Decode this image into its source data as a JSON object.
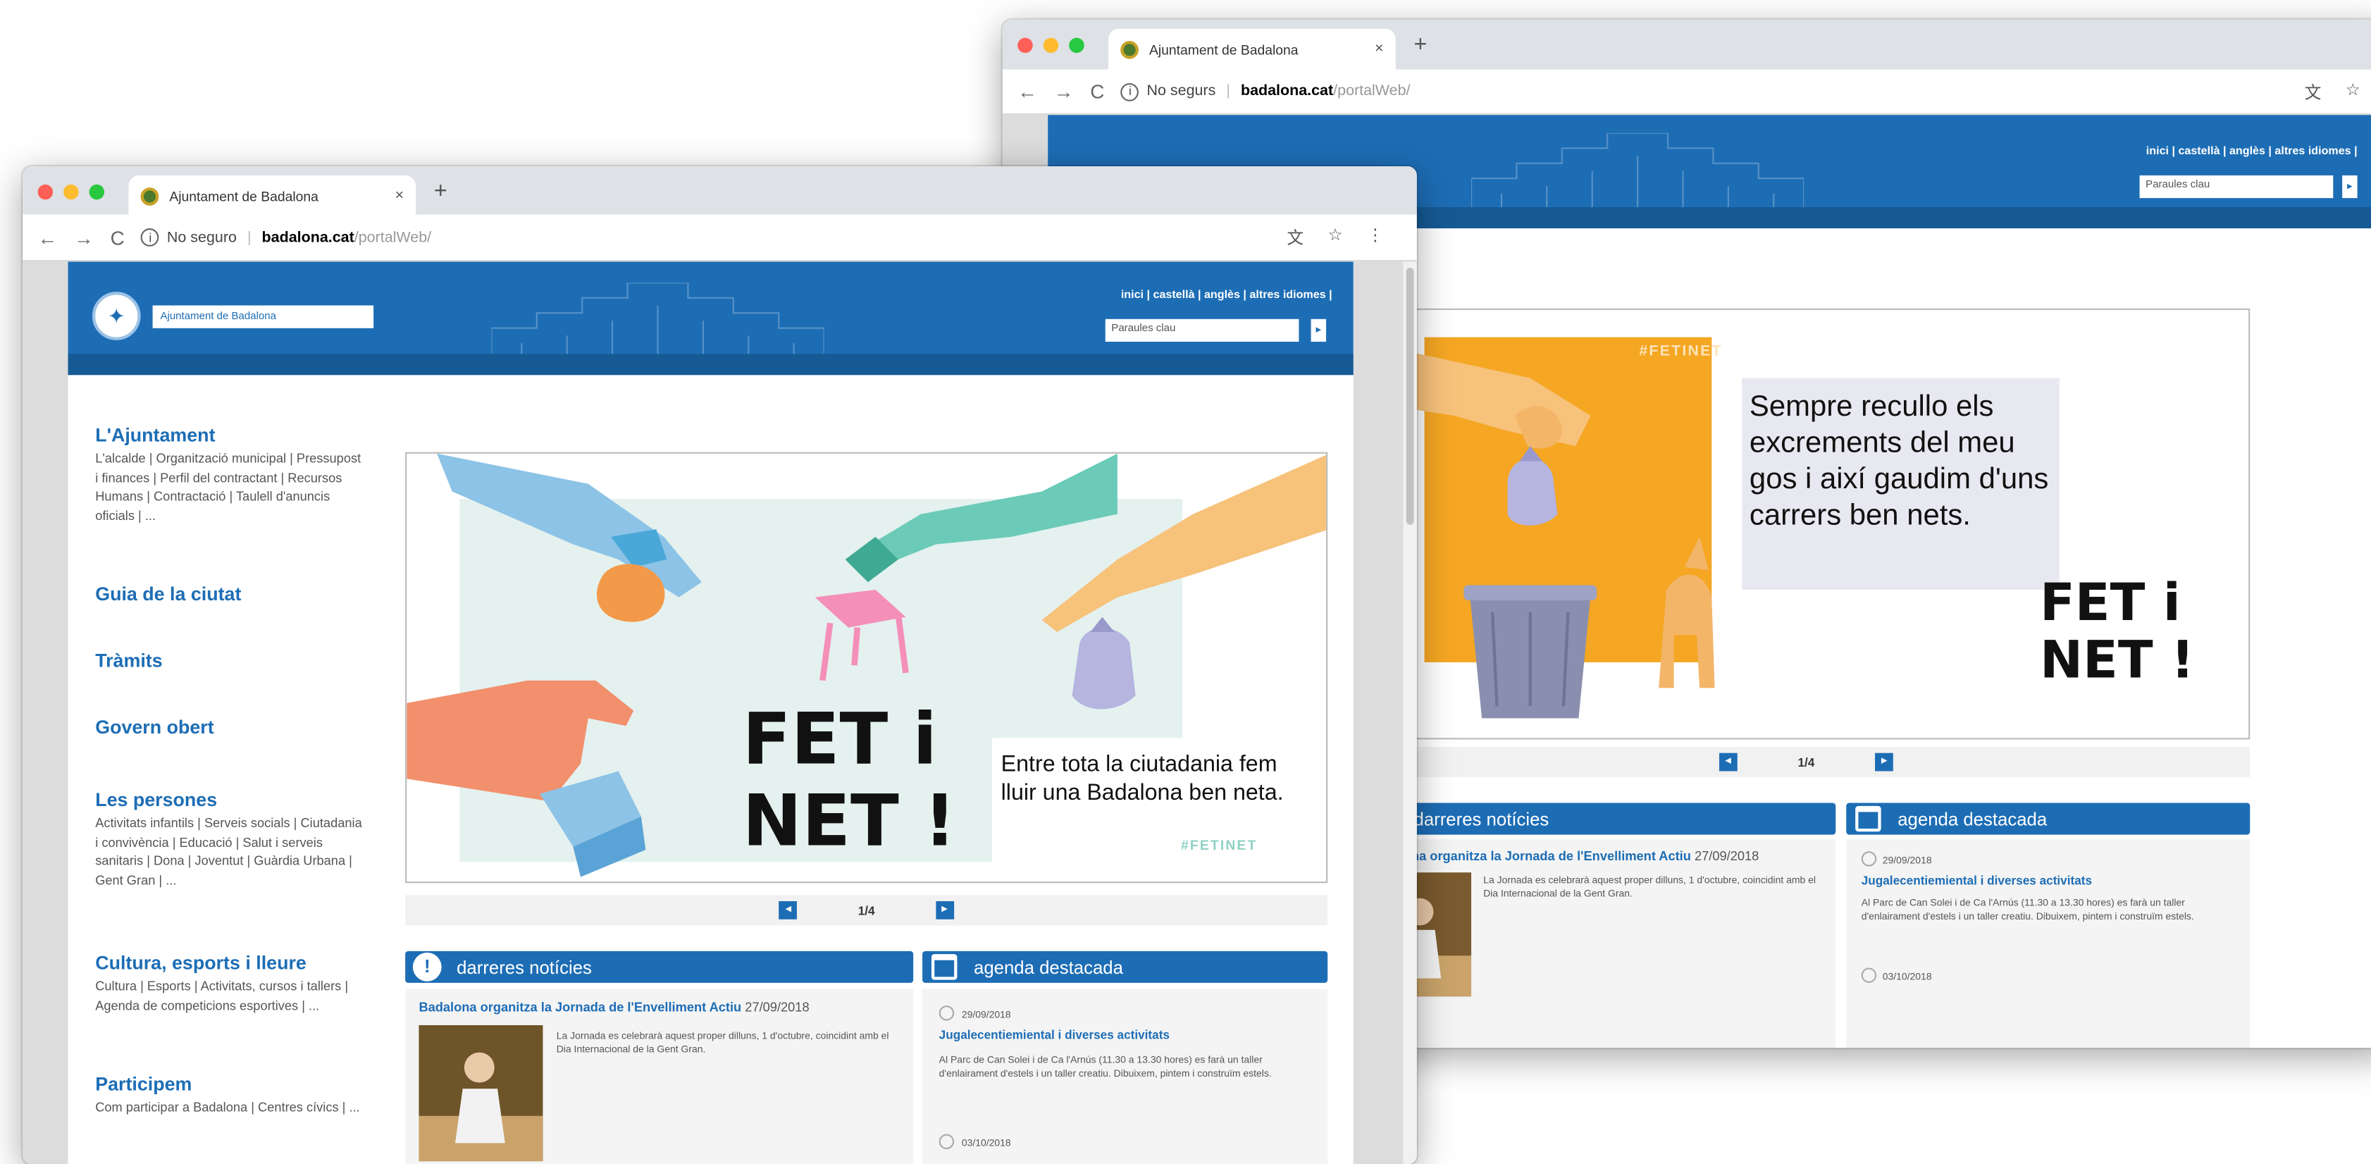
{
  "browser": {
    "tab_title": "Ajuntament de Badalona",
    "tab_close": "×",
    "new_tab": "+",
    "back": "←",
    "forward": "→",
    "reload": "C",
    "info": "i",
    "not_secure": "No seguro",
    "not_secure_back": "No segurs",
    "url_host": "badalona.cat",
    "url_path": "/portalWeb/",
    "translate": "文",
    "bookmark": "☆",
    "menu": "⋮"
  },
  "site": {
    "logo_text": "Ajuntament de Badalona",
    "lang_links": "inici  |  castellà  |  anglès  |  altres idiomes  |",
    "search_placeholder": "Paraules clau",
    "search_go": "▸"
  },
  "sidebar": [
    {
      "heading": "L'Ajuntament",
      "text": "L'alcalde | Organització municipal | Pressupost i finances | Perfil del contractant | Recursos Humans | Contractació | Taulell d'anuncis oficials | ..."
    },
    {
      "heading": "Guia de la ciutat",
      "text": ""
    },
    {
      "heading": "Tràmits",
      "text": ""
    },
    {
      "heading": "Govern obert",
      "text": ""
    },
    {
      "heading": "Les persones",
      "text": "Activitats infantils | Serveis socials | Ciutadania i convivència | Educació | Salut i serveis sanitaris | Dona | Joventut | Guàrdia Urbana | Gent Gran | ..."
    },
    {
      "heading": "Cultura, esports i lleure",
      "text": "Cultura | Esports | Activitats, cursos i tallers | Agenda de competicions esportives | ..."
    },
    {
      "heading": "Participem",
      "text": "Com participar a Badalona | Centres cívics | ..."
    }
  ],
  "banner_front": {
    "fet": "FET i",
    "net": "NET !",
    "caption": "Entre tota la ciutadania fem lluir una Badalona ben neta.",
    "hashtag": "#FETINET"
  },
  "banner_back": {
    "caption": "Sempre recullo els excrements del meu gos i així gaudim d'uns carrers ben nets.",
    "fet": "FET i",
    "net": "NET !",
    "hashtag": "#FETINET"
  },
  "pager": {
    "prev": "◂",
    "next": "▸",
    "label": "1/4"
  },
  "news": {
    "header": "darreres notícies",
    "icon": "!",
    "title": "Badalona organitza la Jornada de l'Envelliment Actiu",
    "date": "27/09/2018",
    "text": "La Jornada es celebrarà aquest proper dilluns, 1 d'octubre, coincidint amb el Dia Internacional de la Gent Gran."
  },
  "agenda": {
    "header": "agenda destacada",
    "date1": "29/09/2018",
    "title": "Jugalecentiemiental i diverses activitats",
    "text": "Al Parc de Can Solei i de Ca l'Arnús (11.30 a 13.30 hores) es farà un taller d'enlairament d'estels i un taller creatiu. Dibuixem, pintem i construïm estels.",
    "date2": "03/10/2018"
  },
  "colors": {
    "brand_blue": "#1d6db5",
    "orange": "#f5a623"
  }
}
